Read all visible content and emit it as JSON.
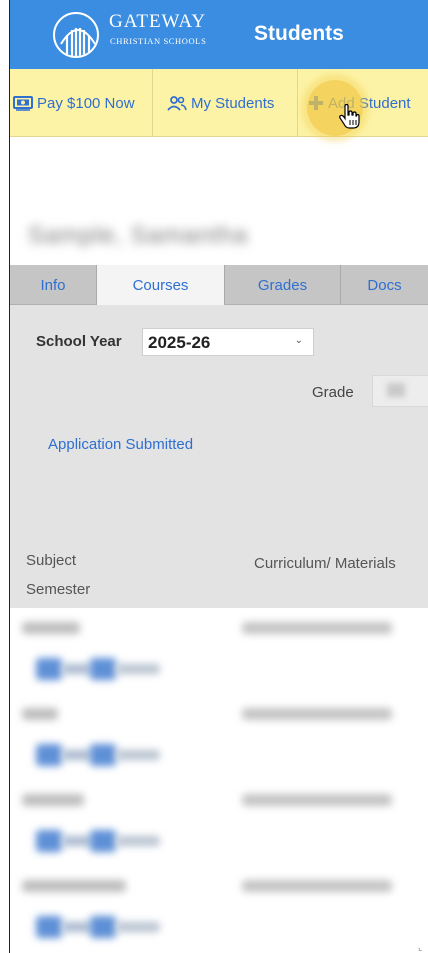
{
  "header": {
    "logo_name": "GATEWAY",
    "logo_sub": "CHRISTIAN SCHOOLS",
    "title": "Students",
    "background": "#3a8de0"
  },
  "toolbar": {
    "background": "#fdf3a6",
    "pay_label": "Pay $100 Now",
    "pay_icon": "payment-icon",
    "my_students_label": "My Students",
    "my_students_icon": "people-icon",
    "add_student_label": "Add Student",
    "add_student_icon": "plus-icon"
  },
  "student": {
    "name": "Sample, Samantha"
  },
  "tabs": [
    {
      "label": "Info",
      "active": false
    },
    {
      "label": "Courses",
      "active": true
    },
    {
      "label": "Grades",
      "active": false
    },
    {
      "label": "Docs",
      "active": false
    }
  ],
  "courses": {
    "school_year_label": "School Year",
    "school_year_value": "2025-26",
    "grade_label": "Grade",
    "application_status": "Application Submitted",
    "columns": {
      "subject": "Subject",
      "curriculum": "Curriculum/ Materials",
      "semester": "Semester"
    }
  },
  "accent": "#2f6fd1"
}
